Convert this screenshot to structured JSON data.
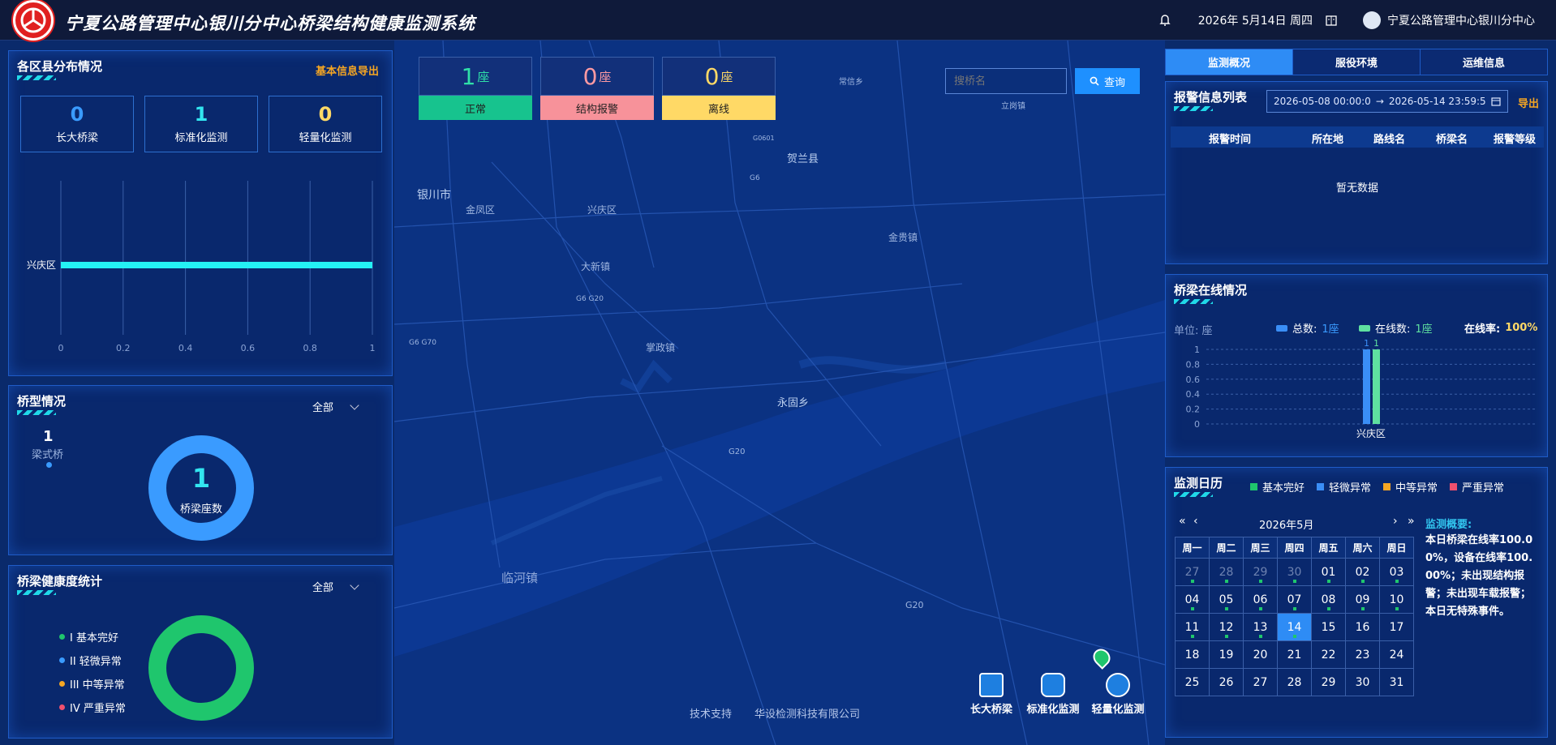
{
  "header": {
    "title": "宁夏公路管理中心银川分中心桥梁结构健康监测系统",
    "date": "2026年 5月14日 周四",
    "user": "宁夏公路管理中心银川分中心"
  },
  "county_panel": {
    "title": "各区县分布情况",
    "export_label": "基本信息导出",
    "stats": [
      {
        "value": "0",
        "label": "长大桥梁",
        "color": "#3a9bff"
      },
      {
        "value": "1",
        "label": "标准化监测",
        "color": "#32e6f0"
      },
      {
        "value": "0",
        "label": "轻量化监测",
        "color": "#ffd966"
      }
    ],
    "chart_data": {
      "type": "bar",
      "orientation": "horizontal",
      "categories": [
        "兴庆区"
      ],
      "values": [
        1
      ],
      "xlim": [
        0,
        1
      ],
      "xticks": [
        "0",
        "0.2",
        "0.4",
        "0.6",
        "0.8",
        "1"
      ]
    }
  },
  "bridge_type_panel": {
    "title": "桥型情况",
    "filter": "全部",
    "count": "1",
    "type_label": "梁式桥",
    "donut_value": "1",
    "donut_label": "桥梁座数"
  },
  "health_panel": {
    "title": "桥梁健康度统计",
    "filter": "全部",
    "legend": [
      {
        "label": "I 基本完好",
        "color": "#1fc66d"
      },
      {
        "label": "II 轻微异常",
        "color": "#3a9bff"
      },
      {
        "label": "III 中等异常",
        "color": "#f5a623"
      },
      {
        "label": "IV 严重异常",
        "color": "#f0506e"
      }
    ]
  },
  "status_badges": [
    {
      "count": "1",
      "unit": "座",
      "label": "正常",
      "color": "#17c38e",
      "numcolor": "#2fe0a8"
    },
    {
      "count": "0",
      "unit": "座",
      "label": "结构报警",
      "color": "#f7929a",
      "numcolor": "#ff9aa2"
    },
    {
      "count": "0",
      "unit": "座",
      "label": "离线",
      "color": "#ffd966",
      "numcolor": "#ffd966"
    }
  ],
  "search": {
    "placeholder": "搜桥名",
    "button": "查询"
  },
  "map_labels": [
    {
      "text": "银川市"
    },
    {
      "text": "金凤区"
    },
    {
      "text": "兴庆区"
    },
    {
      "text": "贺兰县"
    },
    {
      "text": "金贵镇"
    },
    {
      "text": "大新镇"
    },
    {
      "text": "掌政镇"
    },
    {
      "text": "永固乡"
    },
    {
      "text": "临河镇"
    },
    {
      "text": "常信乡"
    },
    {
      "text": "立岗镇"
    },
    {
      "text": "G20"
    },
    {
      "text": "G6"
    },
    {
      "text": "G6 G20"
    },
    {
      "text": "G6 G70"
    },
    {
      "text": "G0601"
    }
  ],
  "map_footer": {
    "support": "技术支持",
    "company": "华设检测科技有限公司"
  },
  "map_buttons": [
    "长大桥梁",
    "标准化监测",
    "轻量化监测"
  ],
  "tabs": [
    "监测概况",
    "服役环境",
    "运维信息"
  ],
  "alarm_panel": {
    "title": "报警信息列表",
    "export_label": "导出",
    "start": "2026-05-08 00:00:0",
    "end": "2026-05-14 23:59:5",
    "columns": [
      "报警时间",
      "所在地",
      "路线名",
      "桥梁名",
      "报警等级"
    ],
    "empty": "暂无数据"
  },
  "online_panel": {
    "title": "桥梁在线情况",
    "unit": "单位: 座",
    "total_label": "总数:",
    "total": "1座",
    "online_label": "在线数:",
    "online": "1座",
    "rate_label": "在线率:",
    "rate": "100%",
    "chart_data": {
      "type": "bar",
      "categories": [
        "兴庆区"
      ],
      "series": [
        {
          "name": "总数",
          "values": [
            1
          ],
          "color": "#3a8ef6"
        },
        {
          "name": "在线数",
          "values": [
            1
          ],
          "color": "#5fe0a0"
        }
      ],
      "ylim": [
        0,
        1
      ],
      "yticks": [
        "1",
        "0.8",
        "0.6",
        "0.4",
        "0.2",
        "0"
      ]
    }
  },
  "calendar_panel": {
    "title": "监测日历",
    "legend": [
      {
        "label": "基本完好",
        "color": "#1fc66d"
      },
      {
        "label": "轻微异常",
        "color": "#3a8ef6"
      },
      {
        "label": "中等异常",
        "color": "#f5a623"
      },
      {
        "label": "严重异常",
        "color": "#f0506e"
      }
    ],
    "month": "2026年5月",
    "nav": {
      "prev_year": "«",
      "prev": "‹",
      "next": "›",
      "next_year": "»"
    },
    "weekdays": [
      "周一",
      "周二",
      "周三",
      "周四",
      "周五",
      "周六",
      "周日"
    ],
    "summary_title": "监测概要:",
    "summary": "本日桥梁在线率100.00%，设备在线率100.00%；未出现结构报警；未出现车载报警；本日无特殊事件。"
  }
}
